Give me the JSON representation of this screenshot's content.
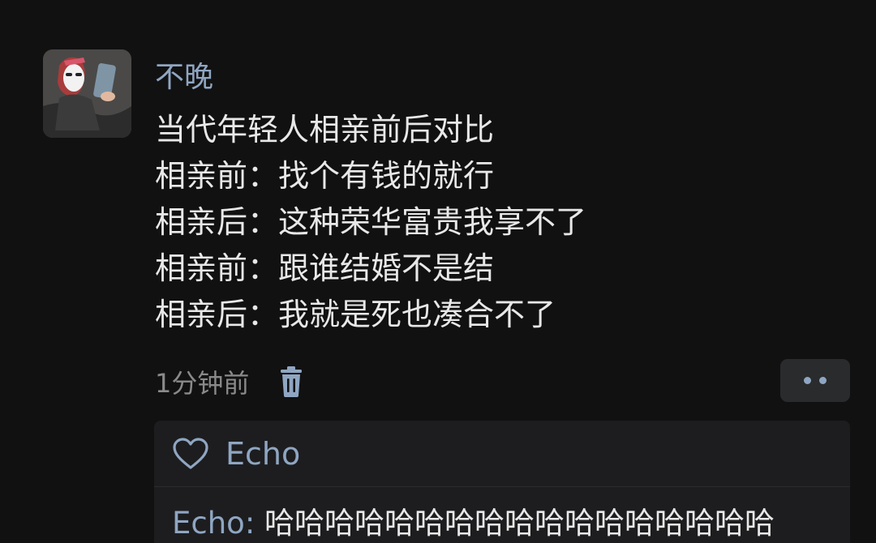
{
  "post": {
    "author": "不晚",
    "avatar_icon": "avatar-photo-icon",
    "lines": [
      "当代年轻人相亲前后对比",
      "相亲前：找个有钱的就行",
      "相亲后：这种荣华富贵我享不了",
      "相亲前：跟谁结婚不是结",
      "相亲后：我就是死也凑合不了"
    ],
    "time": "1分钟前",
    "delete_icon": "trash-icon",
    "more_icon": "more-dots-icon"
  },
  "interactions": {
    "like_icon": "heart-outline-icon",
    "liker": "Echo",
    "comments": [
      {
        "name": "Echo",
        "separator": ": ",
        "text": "哈哈哈哈哈哈哈哈哈哈哈哈哈哈哈哈哈"
      }
    ]
  },
  "colors": {
    "background": "#111111",
    "accent": "#8fa6c2",
    "text": "#e8e8e8",
    "muted": "#8a8a8a",
    "panel": "#1d1d1f"
  }
}
